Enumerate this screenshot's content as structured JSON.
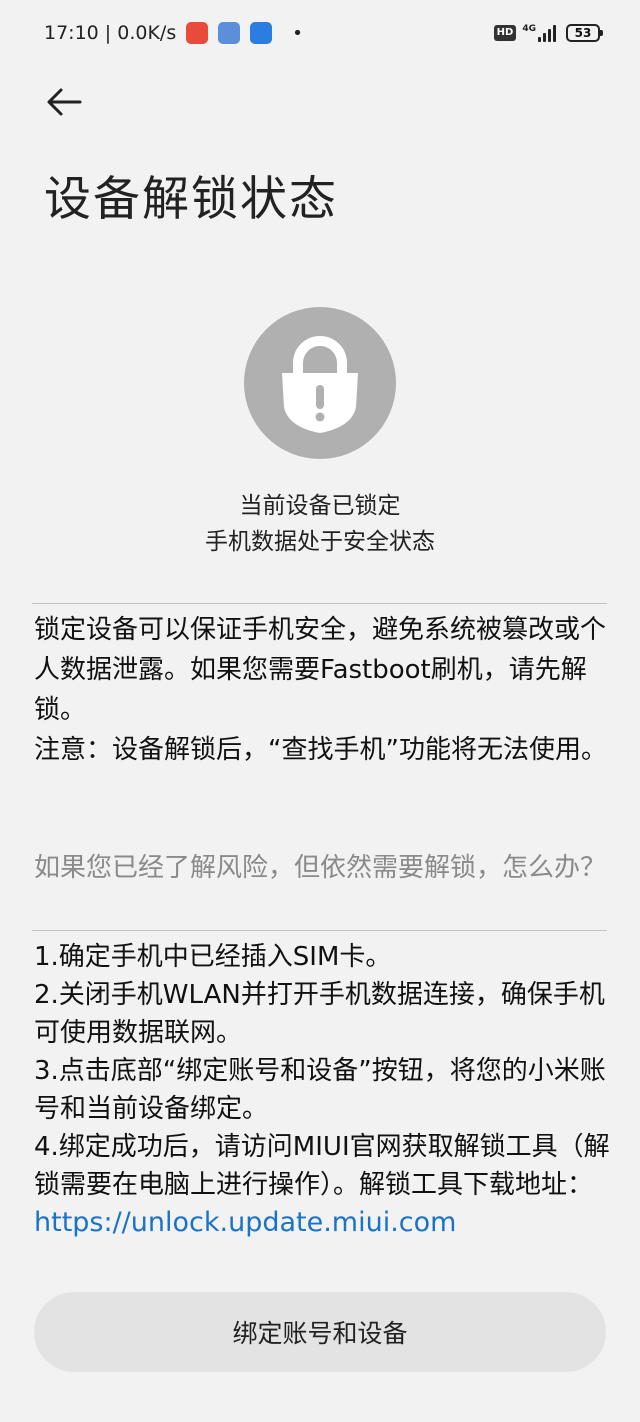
{
  "status_bar": {
    "time_speed": "17:10 | 0.0K/s",
    "dot": "•",
    "hd": "HD",
    "network_type": "4G",
    "battery": "53"
  },
  "header": {
    "back_icon": "arrow-left-icon",
    "title": "设备解锁状态"
  },
  "lock_status": {
    "icon": "lock-warning-icon",
    "icon_color": "#b0b0b0",
    "line1": "当前设备已锁定",
    "line2": "手机数据处于安全状态"
  },
  "description": {
    "paragraph1": "锁定设备可以保证手机安全，避免系统被篡改或个人数据泄露。如果您需要Fastboot刷机，请先解锁。",
    "paragraph2": "注意：设备解锁后，“查找手机”功能将无法使用。"
  },
  "question": "如果您已经了解风险，但依然需要解锁，怎么办？",
  "steps": [
    "1.确定手机中已经插入SIM卡。",
    "2.关闭手机WLAN并打开手机数据连接，确保手机可使用数据联网。",
    "3.点击底部“绑定账号和设备”按钮，将您的小米账号和当前设备绑定。",
    "4.绑定成功后，请访问MIUI官网获取解锁工具（解锁需要在电脑上进行操作）。解锁工具下载地址："
  ],
  "download_link": "https://unlock.update.miui.com",
  "bind_button_label": "绑定账号和设备",
  "colors": {
    "background": "#f2f2f2",
    "link": "#1a73c8",
    "button_bg": "#e3e3e3",
    "muted_text": "#8a8a8a"
  }
}
